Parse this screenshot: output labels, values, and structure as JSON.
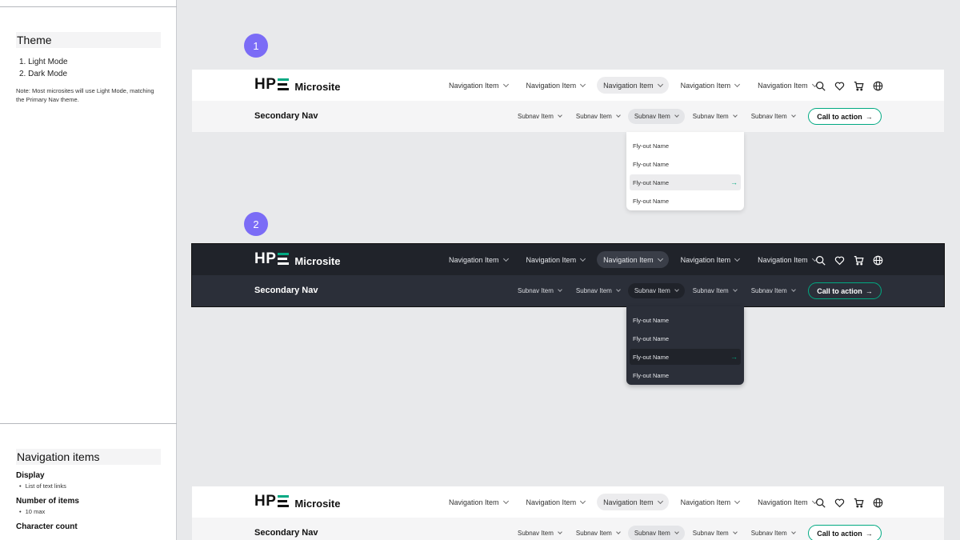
{
  "doc": {
    "theme": {
      "heading": "Theme",
      "items": [
        "1. Light Mode",
        "2. Dark Mode"
      ],
      "note": "Note: Most microsites will use Light Mode, matching the Primary Nav theme."
    },
    "navigation": {
      "heading": "Navigation items",
      "display_label": "Display",
      "display_value": "List of text links",
      "count_label": "Number of items",
      "count_value": "10 max",
      "char_label": "Character count"
    }
  },
  "badges": [
    "1",
    "2"
  ],
  "nav": {
    "logo_letters": [
      "H",
      "P"
    ],
    "site_name": "Microsite",
    "items": [
      "Navigation Item",
      "Navigation Item",
      "Navigation Item",
      "Navigation Item",
      "Navigation Item"
    ],
    "secondary_title": "Secondary Nav",
    "subnav": [
      "Subnav Item",
      "Subnav Item",
      "Subnav Item",
      "Subnav Item",
      "Subnav Item"
    ],
    "cta": "Call to action",
    "cta_arrow": "→",
    "flyout": [
      "Fly-out Name",
      "Fly-out Name",
      "Fly-out Name",
      "Fly-out Name"
    ],
    "flyout_arrow": "→",
    "icons": [
      "search-icon",
      "heart-icon",
      "cart-icon",
      "globe-icon"
    ]
  },
  "colors": {
    "accent": "#01a982",
    "badge": "#7b6cf6",
    "dark_primary": "#20232a",
    "dark_secondary": "#2b2f39"
  }
}
